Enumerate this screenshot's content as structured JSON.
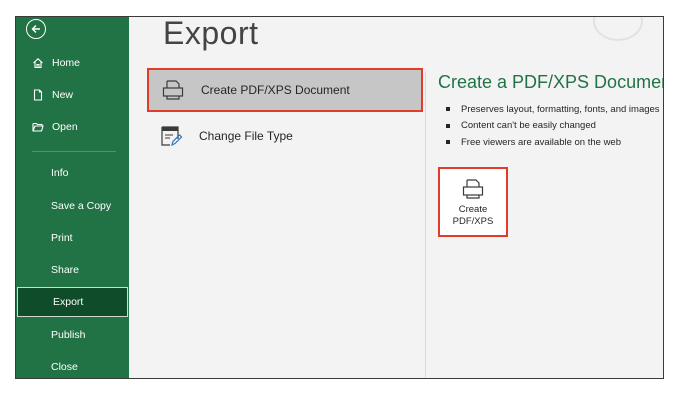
{
  "sidebar": {
    "back_icon": "back-arrow-icon",
    "top_items": [
      {
        "label": "Home",
        "icon": "home-icon"
      },
      {
        "label": "New",
        "icon": "new-document-icon"
      },
      {
        "label": "Open",
        "icon": "folder-open-icon"
      }
    ],
    "sub_items": [
      {
        "label": "Info"
      },
      {
        "label": "Save a Copy"
      },
      {
        "label": "Print"
      },
      {
        "label": "Share"
      },
      {
        "label": "Export",
        "active": true
      },
      {
        "label": "Publish"
      },
      {
        "label": "Close"
      }
    ]
  },
  "main": {
    "title": "Export",
    "options": [
      {
        "label": "Create PDF/XPS Document",
        "icon": "printer-icon",
        "selected": true
      },
      {
        "label": "Change File Type",
        "icon": "change-file-type-icon",
        "selected": false
      }
    ]
  },
  "panel": {
    "title": "Create a PDF/XPS Document",
    "bullets": [
      "Preserves layout, formatting, fonts, and images",
      "Content can't be easily changed",
      "Free viewers are available on the web"
    ],
    "button_line1": "Create",
    "button_line2": "PDF/XPS",
    "button_icon": "printer-icon"
  },
  "colors": {
    "sidebar_bg": "#217346",
    "sidebar_active": "#0f4c2a",
    "accent_green": "#217346",
    "highlight_border": "#e23b2b",
    "main_bg": "#f3f3f3"
  }
}
